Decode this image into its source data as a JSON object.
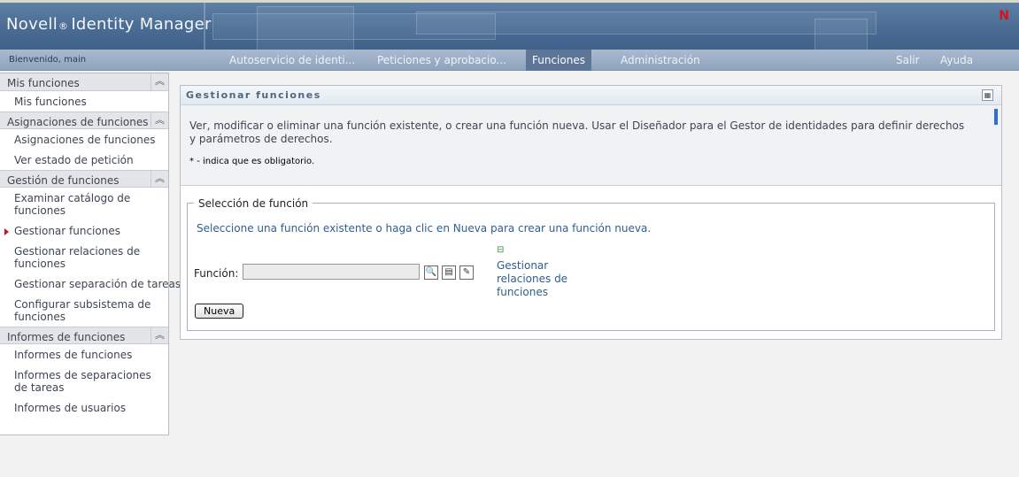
{
  "header": {
    "brand_name": "Novell",
    "brand_reg": "®",
    "brand_product": "Identity Manager",
    "logo_letter": "N"
  },
  "nav": {
    "welcome": "Bienvenido, main",
    "tabs": [
      {
        "label": "Autoservicio de identi..."
      },
      {
        "label": "Peticiones y aprobacio..."
      },
      {
        "label": "Funciones"
      },
      {
        "label": "Administración"
      }
    ],
    "active_tab": "Funciones",
    "logout": "Salir",
    "help": "Ayuda"
  },
  "sidebar": {
    "sections": [
      {
        "title": "Mis funciones",
        "items": [
          {
            "label": "Mis funciones"
          }
        ]
      },
      {
        "title": "Asignaciones de funciones",
        "items": [
          {
            "label": "Asignaciones de funciones"
          },
          {
            "label": "Ver estado de petición"
          }
        ]
      },
      {
        "title": "Gestión de funciones",
        "items": [
          {
            "label": "Examinar catálogo de funciones"
          },
          {
            "label": "Gestionar funciones"
          },
          {
            "label": "Gestionar relaciones de funciones"
          },
          {
            "label": "Gestionar separación de tareas"
          },
          {
            "label": "Configurar subsistema de funciones"
          }
        ]
      },
      {
        "title": "Informes de funciones",
        "items": [
          {
            "label": "Informes de funciones"
          },
          {
            "label": "Informes de separaciones de tareas"
          },
          {
            "label": "Informes de usuarios"
          }
        ]
      }
    ],
    "selected_item": "Gestionar funciones",
    "collapse_icon": "chevron-up-double"
  },
  "panel": {
    "title": "Gestionar funciones",
    "description": "Ver, modificar o eliminar una función existente, o crear una función nueva. Usar el Diseñador para el Gestor de identidades para definir derechos y parámetros de derechos.",
    "required_note": "* - indica que es obligatorio.",
    "fieldset": {
      "legend": "Selección de función",
      "hint": "Seleccione una función existente o haga clic en Nueva para crear una función nueva.",
      "field_label": "Función:",
      "field_value": "",
      "relations_link": "Gestionar relaciones de funciones",
      "new_button": "Nueva"
    }
  },
  "colors": {
    "banner": "#4a6c93",
    "accent_link": "#2e5f8e",
    "selected_marker": "#c8161d",
    "logo": "#dd1111"
  }
}
